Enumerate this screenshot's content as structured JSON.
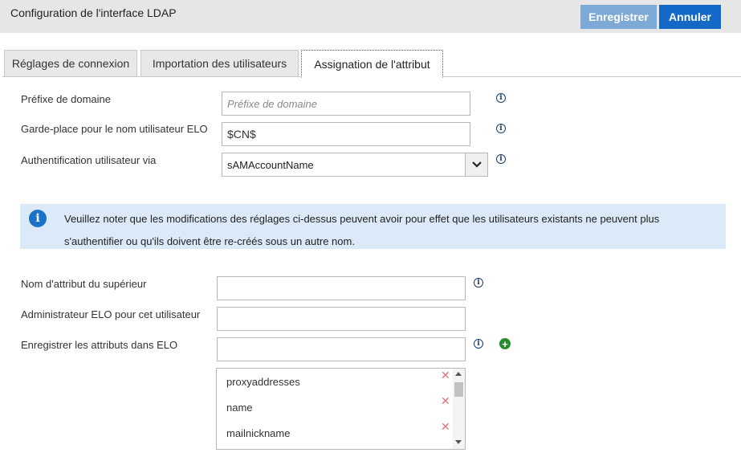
{
  "header": {
    "title": "Configuration de l'interface LDAP",
    "save_label": "Enregistrer",
    "cancel_label": "Annuler"
  },
  "tabs": [
    {
      "label": "Réglages de connexion"
    },
    {
      "label": "Importation des utilisateurs"
    },
    {
      "label": "Assignation de l'attribut",
      "active": true
    }
  ],
  "form": {
    "domain_prefix": {
      "label": "Préfixe de domaine",
      "value": "",
      "placeholder": "Préfixe de domaine"
    },
    "elo_username_placeholder": {
      "label": "Garde-place pour le nom utilisateur ELO",
      "value": "$CN$"
    },
    "auth_via": {
      "label": "Authentification utilisateur via",
      "value": "sAMAccountName"
    }
  },
  "notice": {
    "text": "Veuillez noter que les modifications des réglages ci-dessus peuvent avoir pour effet que les utilisateurs existants ne peuvent plus s'authentifier ou qu'ils doivent être re-créés sous un autre nom."
  },
  "form2": {
    "superior_attribute": {
      "label": "Nom d'attribut du supérieur",
      "value": ""
    },
    "elo_admin": {
      "label": "Administrateur ELO pour cet utilisateur",
      "value": ""
    },
    "save_attributes": {
      "label": "Enregistrer les attributs dans ELO",
      "value": ""
    }
  },
  "attribute_list": [
    "proxyaddresses",
    "name",
    "mailnickname"
  ],
  "icons": {
    "info": "info-icon",
    "add": "plus-circle-icon",
    "remove": "close-icon",
    "dropdown": "chevron-down-icon"
  },
  "colors": {
    "save_button": "#7da9d6",
    "cancel_button": "#1469c7",
    "notice_bg": "#dce9f8",
    "add_icon": "#2a8a2e",
    "remove_icon": "#d9707d"
  }
}
